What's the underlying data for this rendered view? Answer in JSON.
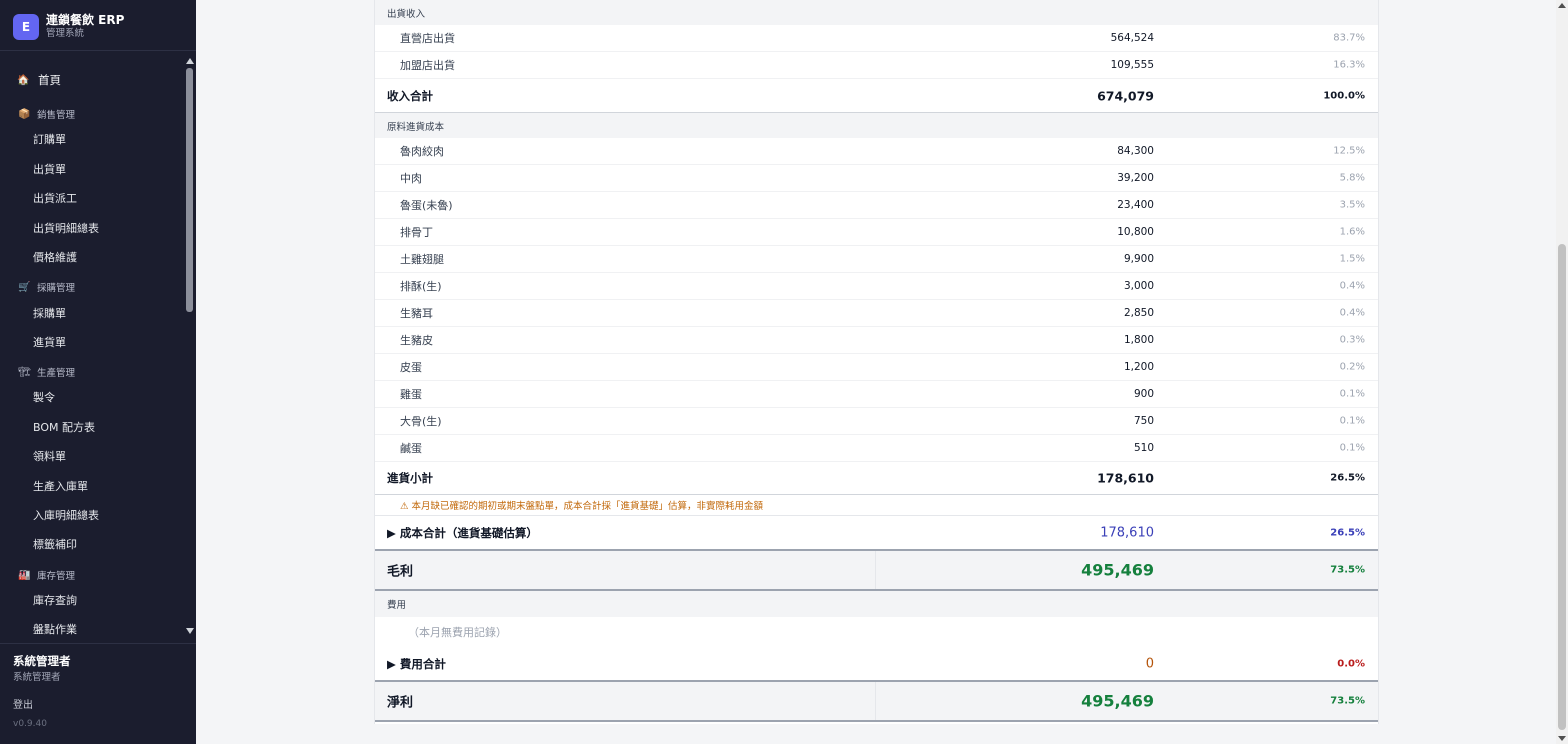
{
  "app": {
    "logo_letter": "E",
    "title": "連鎖餐飲 ERP",
    "subtitle": "管理系統"
  },
  "nav": {
    "home": {
      "icon": "🏠",
      "label": "首頁"
    },
    "groups": [
      {
        "icon": "📦",
        "label": "銷售管理",
        "items": [
          "訂購單",
          "出貨單",
          "出貨派工",
          "出貨明細總表",
          "價格維護"
        ]
      },
      {
        "icon": "🛒",
        "label": "採購管理",
        "items": [
          "採購單",
          "進貨單"
        ]
      },
      {
        "icon": "🏗",
        "label": "生產管理",
        "items": [
          "製令",
          "BOM 配方表",
          "領料單",
          "生產入庫單",
          "入庫明細總表",
          "標籤補印"
        ]
      },
      {
        "icon": "🏭",
        "label": "庫存管理",
        "items": [
          "庫存查詢",
          "盤點作業"
        ]
      }
    ]
  },
  "user": {
    "name": "系統管理者",
    "role": "系統管理者",
    "logout": "登出",
    "version": "v0.9.40"
  },
  "report": {
    "revenue_section": "出貨收入",
    "revenue_lines": [
      {
        "label": "直營店出貨",
        "value": "564,524",
        "pct": "83.7%"
      },
      {
        "label": "加盟店出貨",
        "value": "109,555",
        "pct": "16.3%"
      }
    ],
    "revenue_total": {
      "label": "收入合計",
      "value": "674,079",
      "pct": "100.0%"
    },
    "cost_section": "原料進貨成本",
    "cost_lines": [
      {
        "label": "魯肉絞肉",
        "value": "84,300",
        "pct": "12.5%"
      },
      {
        "label": "中肉",
        "value": "39,200",
        "pct": "5.8%"
      },
      {
        "label": "魯蛋(未魯)",
        "value": "23,400",
        "pct": "3.5%"
      },
      {
        "label": "排骨丁",
        "value": "10,800",
        "pct": "1.6%"
      },
      {
        "label": "土雞翅腿",
        "value": "9,900",
        "pct": "1.5%"
      },
      {
        "label": "排酥(生)",
        "value": "3,000",
        "pct": "0.4%"
      },
      {
        "label": "生豬耳",
        "value": "2,850",
        "pct": "0.4%"
      },
      {
        "label": "生豬皮",
        "value": "1,800",
        "pct": "0.3%"
      },
      {
        "label": "皮蛋",
        "value": "1,200",
        "pct": "0.2%"
      },
      {
        "label": "雞蛋",
        "value": "900",
        "pct": "0.1%"
      },
      {
        "label": "大骨(生)",
        "value": "750",
        "pct": "0.1%"
      },
      {
        "label": "鹹蛋",
        "value": "510",
        "pct": "0.1%"
      }
    ],
    "purchase_subtotal": {
      "label": "進貨小計",
      "value": "178,610",
      "pct": "26.5%"
    },
    "warning": "⚠ 本月缺已確認的期初或期末盤點單，成本合計採「進貨基礎」估算，非實際耗用金額",
    "cost_total": {
      "label": "▶ 成本合計（進貨基礎估算）",
      "value": "178,610",
      "pct": "26.5%"
    },
    "gross_profit": {
      "label": "毛利",
      "value": "495,469",
      "pct": "73.5%"
    },
    "expense_section": "費用",
    "expense_empty": "（本月無費用記錄）",
    "expense_total": {
      "label": "▶ 費用合計",
      "value": "0",
      "pct": "0.0%"
    },
    "net_profit": {
      "label": "淨利",
      "value": "495,469",
      "pct": "73.5%"
    }
  }
}
